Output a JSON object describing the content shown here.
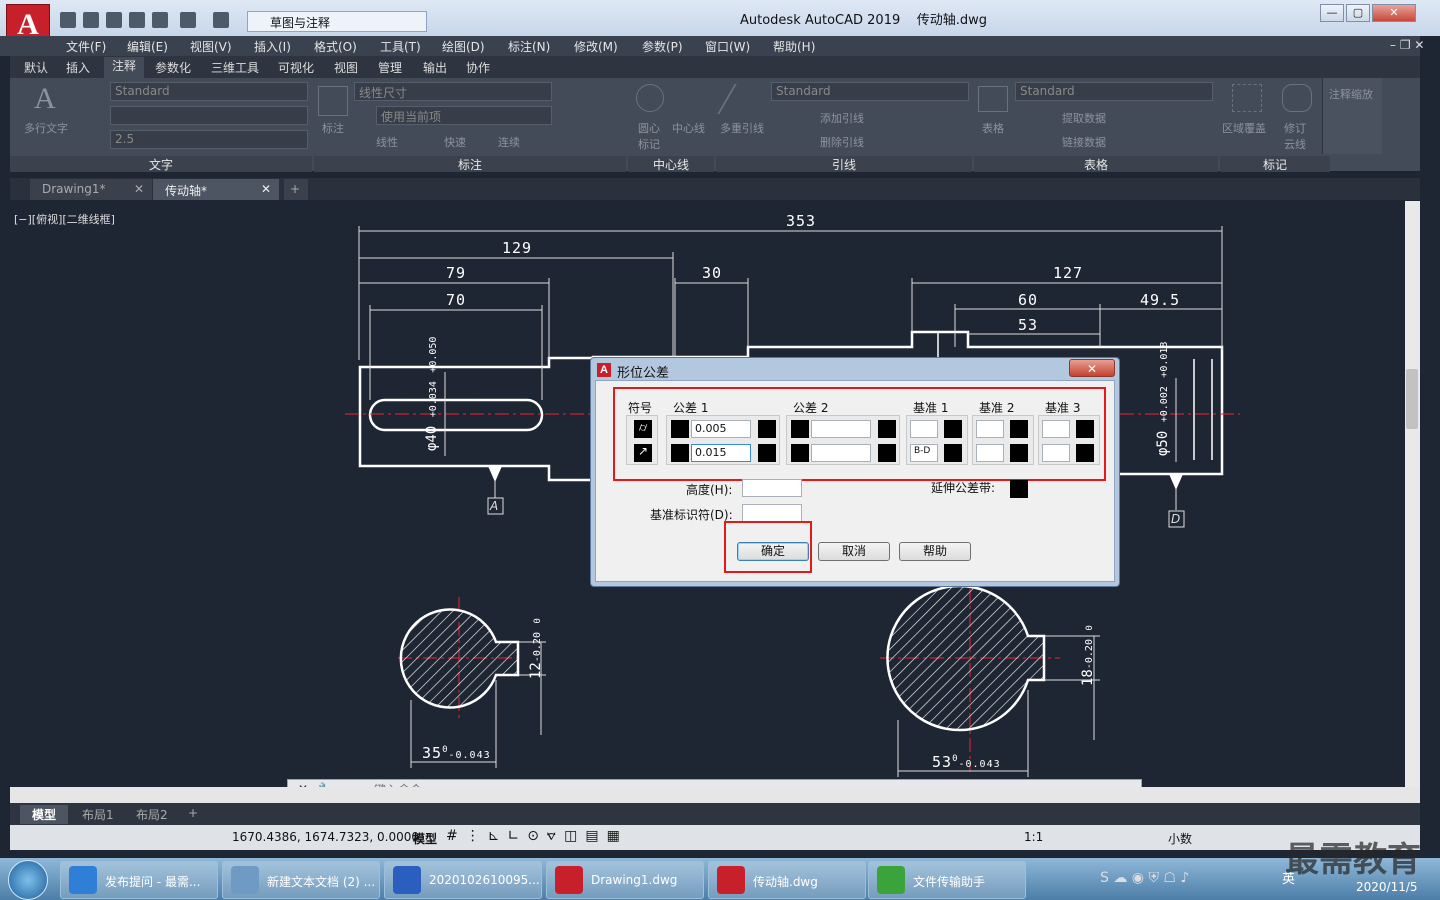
{
  "window": {
    "title": "Autodesk AutoCAD 2019",
    "file": "传动轴.dwg",
    "workspace": "草图与注释",
    "logo": "A"
  },
  "menu": [
    "文件(F)",
    "编辑(E)",
    "视图(V)",
    "插入(I)",
    "格式(O)",
    "工具(T)",
    "绘图(D)",
    "标注(N)",
    "修改(M)",
    "参数(P)",
    "窗口(W)",
    "帮助(H)"
  ],
  "ribbon_tabs": [
    "默认",
    "插入",
    "注释",
    "参数化",
    "三维工具",
    "可视化",
    "视图",
    "管理",
    "输出",
    "协作"
  ],
  "ribbon": {
    "text_style": "Standard",
    "text_height": "2.5",
    "multiline_text": "多行文字",
    "dim_style": "线性尺寸",
    "use_current": "使用当前项",
    "dim_label": "标注",
    "linear": "线性",
    "quick": "快速",
    "continue": "连续",
    "center_mark": "圆心标记",
    "center_line": "中心线",
    "mleader": "多重引线",
    "mleader_style": "Standard",
    "add_leader": "添加引线",
    "remove_leader": "删除引线",
    "table": "表格",
    "table_style": "Standard",
    "extract": "提取数据",
    "link": "链接数据",
    "wipeout": "区域覆盖",
    "revcloud": "修订云线",
    "anno_scale": "注释缩放",
    "panels": [
      "文字",
      "标注",
      "中心线",
      "引线",
      "表格",
      "标记"
    ]
  },
  "doc_tabs": [
    "Drawing1*",
    "传动轴*"
  ],
  "viewport_label": "[−][俯视][二维线框]",
  "dims": {
    "d353": "353",
    "d129": "129",
    "d79": "79",
    "d70": "70",
    "d30": "30",
    "d127": "127",
    "d60": "60",
    "d49": "49.5",
    "d53": "53",
    "dia40": "φ40",
    "tol40a": "+0.050",
    "tol40b": "+0.034",
    "dia50": "φ50",
    "tol50a": "+0.018",
    "tol50b": "+0.002",
    "datumA": "A",
    "datumD": "D",
    "s35": "35",
    "s35t": "-0.043",
    "s35z": "0",
    "s12": "12",
    "s12t": "-0.20",
    "s12z": "0",
    "s53": "53",
    "s53t": "-0.043",
    "s53z": "0",
    "s18": "18",
    "s18t": "-0.20",
    "s18z": "0"
  },
  "dialog": {
    "title": "形位公差",
    "close": "✕",
    "symbol": "符号",
    "tol1": "公差 1",
    "tol2": "公差 2",
    "datum1": "基准 1",
    "datum2": "基准 2",
    "datum3": "基准 3",
    "row1_tol1": "0.005",
    "row2_tol1": "0.015",
    "row2_datum1": "B-D",
    "height": "高度(H):",
    "proj_zone": "延伸公差带:",
    "datum_id": "基准标识符(D):",
    "ok": "确定",
    "cancel": "取消",
    "help": "帮助"
  },
  "cmd": {
    "placeholder": "键入命令"
  },
  "layout_tabs": [
    "模型",
    "布局1",
    "布局2"
  ],
  "status": {
    "coords": "1670.4386, 1674.7323, 0.0000",
    "model": "模型",
    "scale": "1:1",
    "units": "小数"
  },
  "taskbar": [
    {
      "label": "发布提问 - 最需...",
      "color": "#2f7fd6"
    },
    {
      "label": "新建文本文档 (2) ...",
      "color": "#6e9ac4"
    },
    {
      "label": "2020102610095...",
      "color": "#2b5fbf"
    },
    {
      "label": "Drawing1.dwg",
      "color": "#c8202a"
    },
    {
      "label": "传动轴.dwg",
      "color": "#c8202a"
    },
    {
      "label": "文件传输助手",
      "color": "#3aa33a"
    }
  ],
  "tray": {
    "ime": "英",
    "date": "2020/11/5",
    "watermark": "最需教育"
  }
}
